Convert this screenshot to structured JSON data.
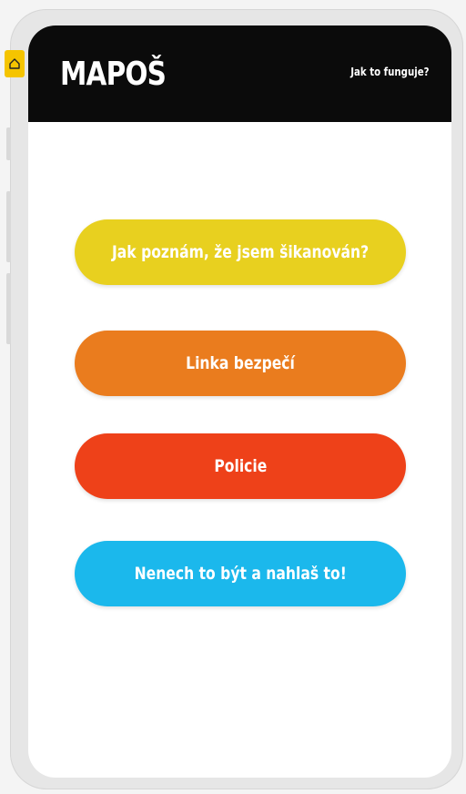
{
  "app": {
    "title": "MAPOŠ",
    "help_link": "Jak to funguje?"
  },
  "buttons": [
    {
      "label": "Jak poznám, že jsem šikanován?",
      "color": "#e8d01f"
    },
    {
      "label": "Linka bezpečí",
      "color": "#ea7c1e"
    },
    {
      "label": "Policie",
      "color": "#ee4119"
    },
    {
      "label": "Nenech to být a nahlaš to!",
      "color": "#1bb8ec"
    }
  ],
  "colors": {
    "header_bg": "#0b0b0b",
    "home_badge": "#f5c400"
  },
  "icons": {
    "home_badge": "home-icon"
  }
}
